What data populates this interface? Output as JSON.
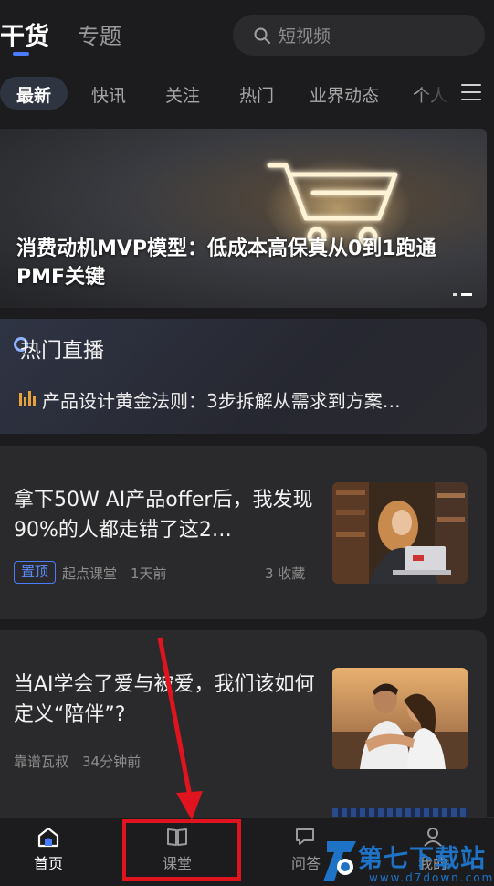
{
  "header": {
    "tab_active": "干货",
    "tab_other": "专题",
    "search_placeholder": "短视频"
  },
  "categories": [
    "最新",
    "快讯",
    "关注",
    "热门",
    "业界动态",
    "个人"
  ],
  "banner": {
    "title": "消费动机MVP模型：低成本高保真从0到1跑通PMF关键"
  },
  "live": {
    "title": "热门直播",
    "item": "产品设计黄金法则：3步拆解从需求到方案…"
  },
  "articles": [
    {
      "title": "拿下50W AI产品offer后，我发现90%的人都走错了这2…",
      "badge": "置顶",
      "author": "起点课堂",
      "time": "1天前",
      "favorites": "3 收藏"
    },
    {
      "title": "当AI学会了爱与被爱，我们该如何定义“陪伴”?",
      "author": "靠谱瓦叔",
      "time": "34分钟前"
    }
  ],
  "nav": {
    "home": "首页",
    "course": "课堂",
    "qa": "问答",
    "me": "我的"
  },
  "watermark": {
    "title": "第七下载站",
    "url": "www.d7down.com"
  },
  "colors": {
    "accent": "#4a7cff",
    "background": "#1c1c1e",
    "annotation": "#e0141e"
  }
}
